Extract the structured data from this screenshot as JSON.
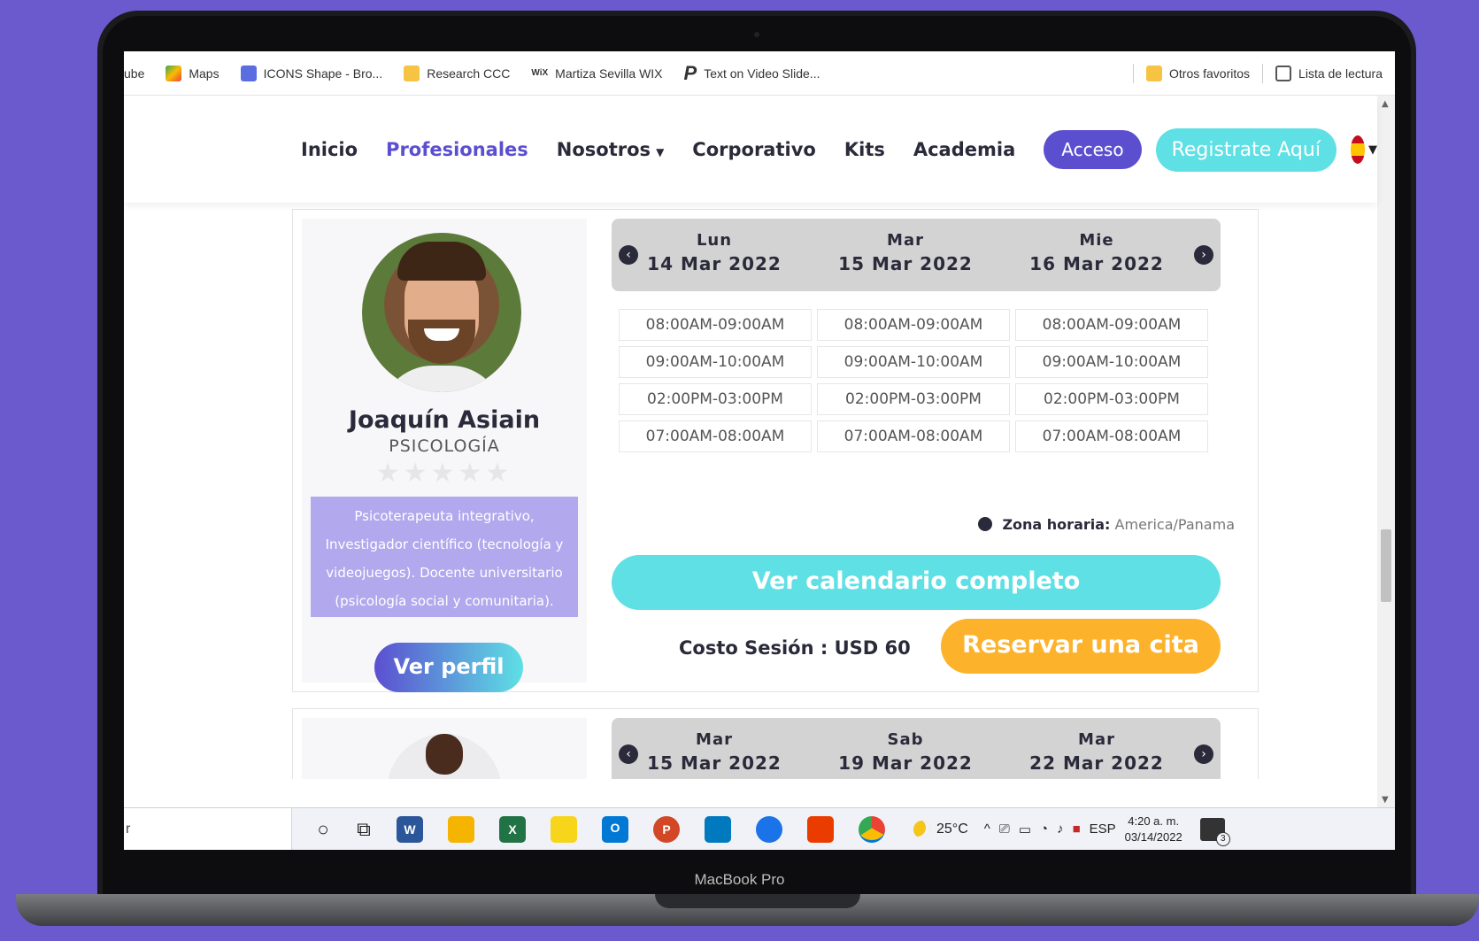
{
  "device_label": "MacBook Pro",
  "bookmarks": {
    "items": [
      {
        "label": "ube",
        "icon": "youtube-icon",
        "color": ""
      },
      {
        "label": "Maps",
        "icon": "maps-icon",
        "color": "#34a853"
      },
      {
        "label": "ICONS Shape - Bro...",
        "icon": "icons-shape-icon",
        "color": "#5b6ee1"
      },
      {
        "label": "Research CCC",
        "icon": "folder-icon",
        "color": "#f6c343"
      },
      {
        "label": "Martiza Sevilla WIX",
        "icon": "wix-icon",
        "color": "#000000"
      },
      {
        "label": "Text on Video Slide...",
        "icon": "p-icon",
        "color": "#222222"
      }
    ],
    "other_favorites": "Otros favoritos",
    "reading_list": "Lista de lectura"
  },
  "nav": {
    "links": [
      "Inicio",
      "Profesionales",
      "Nosotros",
      "Corporativo",
      "Kits",
      "Academia"
    ],
    "acceso": "Acceso",
    "registro": "Registrate Aquí"
  },
  "professional": {
    "name": "Joaquín Asiain",
    "specialty": "PSICOLOGÍA",
    "stars": "★★★★★",
    "rating": 0,
    "bio": "Psicoterapeuta integrativo, Investigador científico (tecnología y videojuegos). Docente universitario (psicología social y comunitaria).",
    "view_profile": "Ver perfil"
  },
  "schedule": {
    "days": [
      {
        "name": "Lun",
        "date": "14 Mar 2022"
      },
      {
        "name": "Mar",
        "date": "15 Mar 2022"
      },
      {
        "name": "Mie",
        "date": "16 Mar 2022"
      }
    ],
    "slots": [
      [
        "08:00AM-09:00AM",
        "08:00AM-09:00AM",
        "08:00AM-09:00AM"
      ],
      [
        "09:00AM-10:00AM",
        "09:00AM-10:00AM",
        "09:00AM-10:00AM"
      ],
      [
        "02:00PM-03:00PM",
        "02:00PM-03:00PM",
        "02:00PM-03:00PM"
      ],
      [
        "07:00AM-08:00AM",
        "07:00AM-08:00AM",
        "07:00AM-08:00AM"
      ]
    ],
    "timezone_label": "Zona horaria:",
    "timezone_value": "America/Panama",
    "full_calendar": "Ver calendario completo",
    "cost": "Costo Sesión : USD 60",
    "book": "Reservar una cita"
  },
  "next_card": {
    "days": [
      {
        "name": "Mar",
        "date": "15 Mar 2022"
      },
      {
        "name": "Sab",
        "date": "19 Mar 2022"
      },
      {
        "name": "Mar",
        "date": "22 Mar 2022"
      }
    ]
  },
  "taskbar": {
    "search_text": "r",
    "apps": [
      {
        "icon": "word-icon",
        "letter": "W",
        "color": "#2b579a"
      },
      {
        "icon": "file-explorer-icon",
        "letter": "",
        "color": "#f5b400"
      },
      {
        "icon": "excel-icon",
        "letter": "X",
        "color": "#217346"
      },
      {
        "icon": "sticky-notes-icon",
        "letter": "",
        "color": "#f7d51b"
      },
      {
        "icon": "outlook-icon",
        "letter": "O",
        "color": "#0078d4"
      },
      {
        "icon": "powerpoint-icon",
        "letter": "P",
        "color": "#d24726"
      },
      {
        "icon": "trello-icon",
        "letter": "",
        "color": "#0079bf"
      },
      {
        "icon": "chrome-canary-icon",
        "letter": "",
        "color": "#1a73e8"
      },
      {
        "icon": "office-icon",
        "letter": "",
        "color": "#eb3c00"
      },
      {
        "icon": "chrome-icon",
        "letter": "",
        "color": "#ea4335"
      }
    ],
    "temperature": "25°C",
    "language": "ESP",
    "time": "4:20 a. m.",
    "date": "03/14/2022",
    "notifications": "3"
  },
  "colors": {
    "background": "#6a5acd",
    "primary": "#5b4fd0",
    "accent": "#5ee0e4",
    "book": "#fdb22b"
  }
}
